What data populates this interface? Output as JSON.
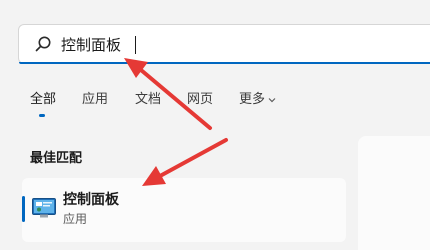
{
  "search": {
    "value": "控制面板",
    "icon": "search-icon"
  },
  "tabs": [
    {
      "label": "全部",
      "active": true
    },
    {
      "label": "应用"
    },
    {
      "label": "文档"
    },
    {
      "label": "网页"
    },
    {
      "label": "更多"
    }
  ],
  "best_match": {
    "title": "最佳匹配",
    "result": {
      "name": "控制面板",
      "type": "应用",
      "icon": "control-panel-icon"
    }
  },
  "annotations": {
    "arrow_color": "#e53935"
  },
  "colors": {
    "accent": "#0067c0",
    "background": "#f3f3f3"
  }
}
